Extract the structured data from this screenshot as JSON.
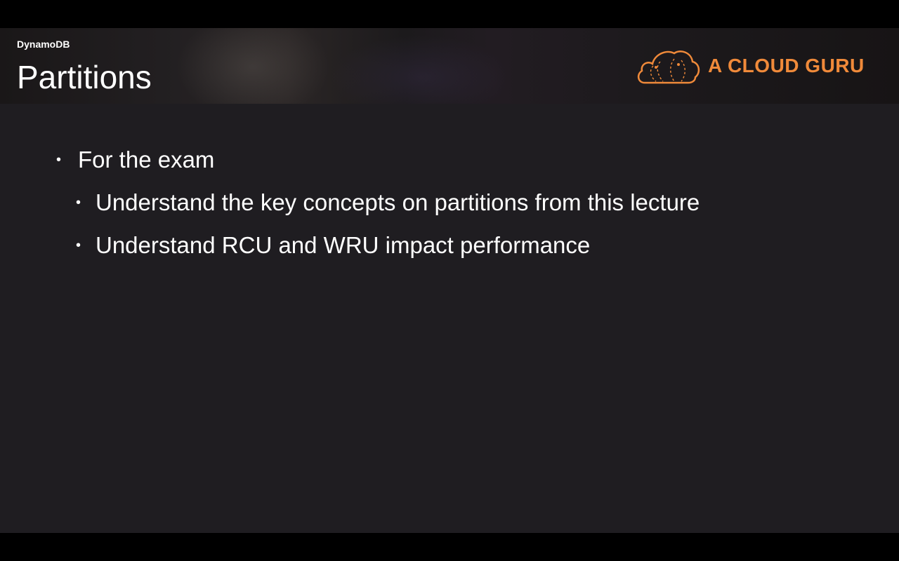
{
  "header": {
    "section": "DynamoDB",
    "title": "Partitions"
  },
  "logo": {
    "text": "A CLOUD GURU",
    "icon": "cloud-icon",
    "color": "#f08a3a"
  },
  "bullets": [
    {
      "level": 1,
      "text": "For the exam"
    },
    {
      "level": 2,
      "text": "Understand the key concepts on partitions from this lecture"
    },
    {
      "level": 2,
      "text": "Understand RCU and WRU impact performance"
    }
  ],
  "colors": {
    "background": "#1f1d21",
    "letterbox": "#000000",
    "text": "#ffffff",
    "accent": "#f08a3a"
  }
}
